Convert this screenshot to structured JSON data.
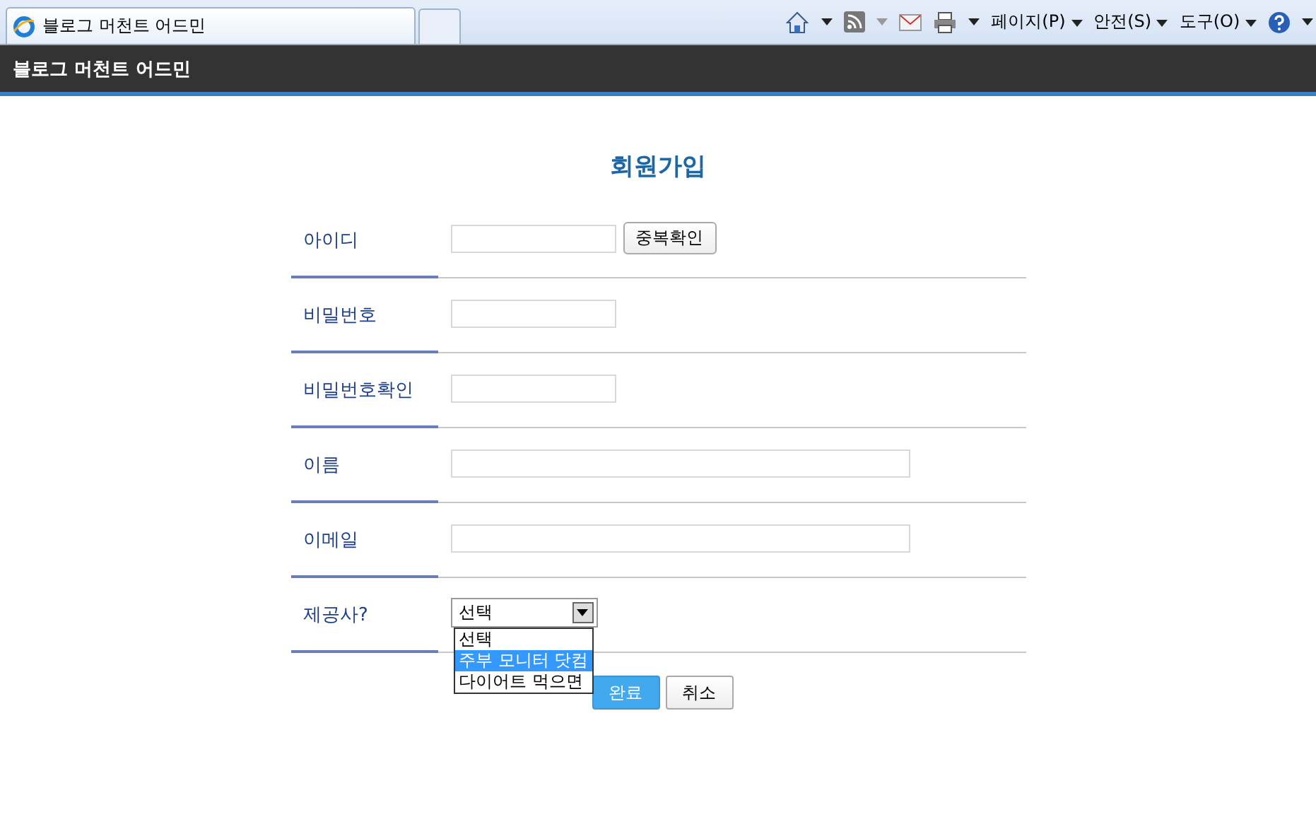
{
  "browser": {
    "tab_title": "블로그 머천트 어드민",
    "menus": [
      {
        "label": "페이지(P)"
      },
      {
        "label": "안전(S)"
      },
      {
        "label": "도구(O)"
      }
    ]
  },
  "header": {
    "title": "블로그 머천트 어드민"
  },
  "form": {
    "title": "회원가입",
    "fields": [
      {
        "label": "아이디",
        "kind": "short",
        "button": "중복확인"
      },
      {
        "label": "비밀번호",
        "kind": "short"
      },
      {
        "label": "비밀번호확인",
        "kind": "short"
      },
      {
        "label": "이름",
        "kind": "long"
      },
      {
        "label": "이메일",
        "kind": "long"
      },
      {
        "label": "제공사?",
        "kind": "select",
        "value": "선택",
        "open": true,
        "options": [
          {
            "label": "선택",
            "highlighted": false
          },
          {
            "label": "주부 모니터 닷컴",
            "highlighted": true
          },
          {
            "label": "다이어트 먹으면",
            "highlighted": false
          }
        ]
      }
    ],
    "buttons": [
      {
        "label": "완료",
        "primary": true
      },
      {
        "label": "취소",
        "primary": false
      }
    ]
  }
}
